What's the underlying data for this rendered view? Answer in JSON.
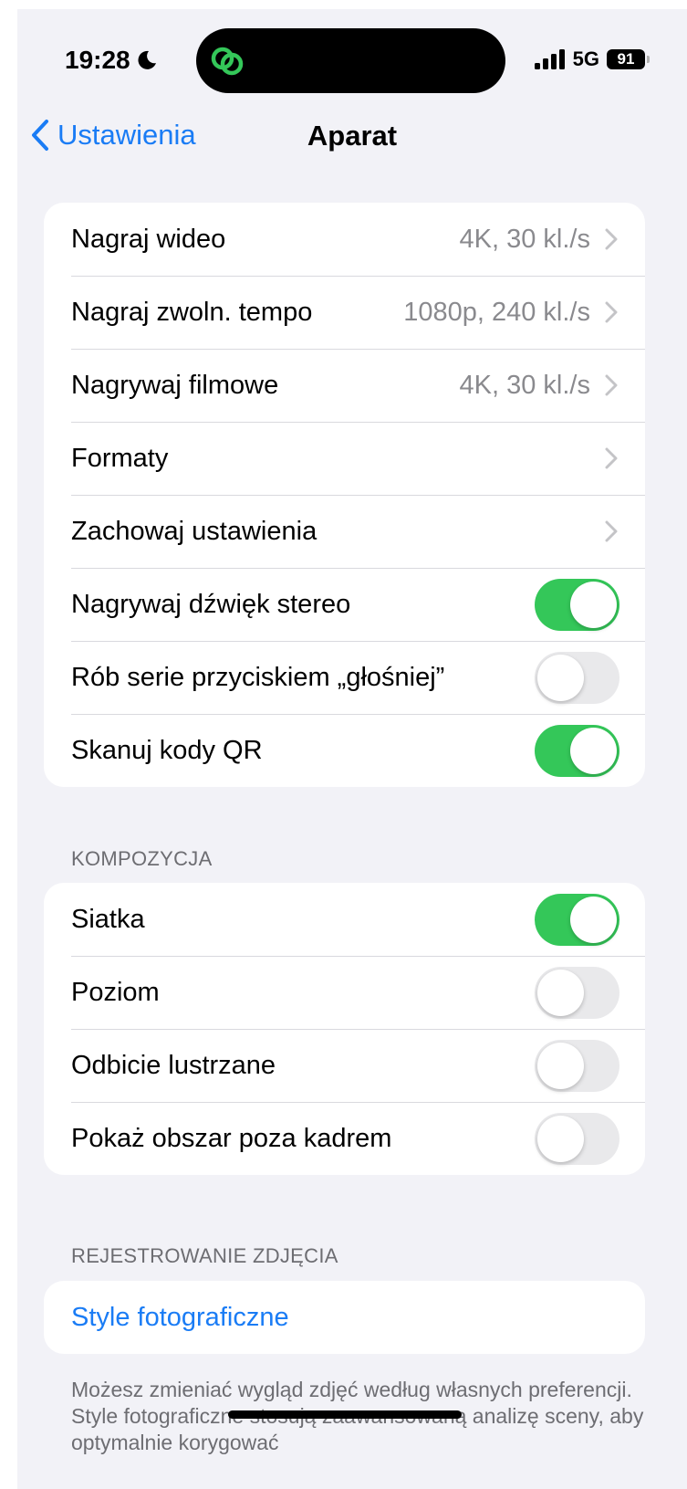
{
  "status_bar": {
    "time": "19:28",
    "network": "5G",
    "battery": "91",
    "icons": [
      "moon-icon",
      "linked-rings-icon",
      "cellular-signal-icon",
      "battery-icon"
    ]
  },
  "nav": {
    "back_label": "Ustawienia",
    "title": "Aparat"
  },
  "colors": {
    "accent": "#1a7cf5",
    "toggle_on": "#34c759",
    "toggle_off": "#e9e9eb",
    "background": "#f2f2f7",
    "island_icon": "#34c759"
  },
  "groups": {
    "video": {
      "rows": [
        {
          "label": "Nagraj wideo",
          "value": "4K, 30 kl./s"
        },
        {
          "label": "Nagraj zwoln. tempo",
          "value": "1080p, 240 kl./s"
        },
        {
          "label": "Nagrywaj filmowe",
          "value": "4K, 30 kl./s"
        },
        {
          "label": "Formaty",
          "value": ""
        },
        {
          "label": "Zachowaj ustawienia",
          "value": ""
        },
        {
          "label": "Nagrywaj dźwięk stereo",
          "toggle": true
        },
        {
          "label": "Rób serie przyciskiem „głośniej”",
          "toggle": false
        },
        {
          "label": "Skanuj kody QR",
          "toggle": true
        }
      ]
    },
    "composition": {
      "header": "KOMPOZYCJA",
      "rows": [
        {
          "label": "Siatka",
          "toggle": true
        },
        {
          "label": "Poziom",
          "toggle": false
        },
        {
          "label": "Odbicie lustrzane",
          "toggle": false
        },
        {
          "label": "Pokaż obszar poza kadrem",
          "toggle": false
        }
      ]
    },
    "capture": {
      "header": "REJESTROWANIE ZDJĘCIA",
      "link_label": "Style fotograficzne",
      "footer": "Możesz zmieniać wygląd zdjęć według własnych preferencji. Style fotograficzne stosują zaawansowaną analizę sceny, aby optymalnie korygować"
    }
  }
}
